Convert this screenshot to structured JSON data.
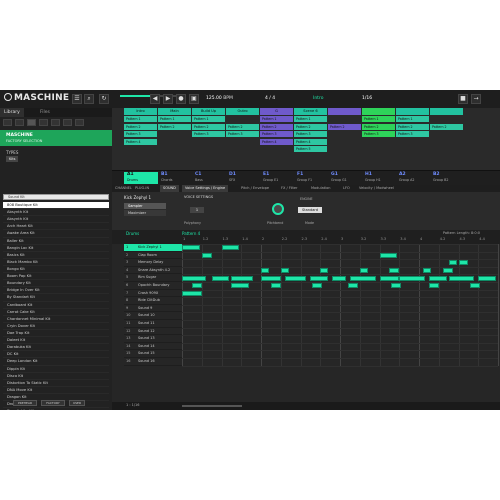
{
  "app": {
    "logo": "MASCHINE"
  },
  "topbar": {
    "bpm_value": "125.00",
    "bpm_unit": "BPM",
    "sig": "4 / 4",
    "nudge": "1/16",
    "mode": "Intro",
    "buttons": [
      "☰",
      "⌕",
      "↻",
      "◀",
      "▶",
      "●",
      "▣",
      "■",
      "→"
    ]
  },
  "library": {
    "tabs": [
      "Library",
      "Files"
    ],
    "factory_title": "MASCHINE",
    "factory_sub": "FACTORY SELECTION",
    "types_label": "TYPES",
    "kits_chip": "Kits",
    "search_value": "Sound Kit",
    "kits": [
      "808 Boutique Kit",
      "Absynth Kit",
      "Absynth Kit",
      "Arch Heart Kit",
      "Awake Area Kit",
      "Baller Kit",
      "Bangin Loc Kit",
      "Basics Kit",
      "Black Mambo Kit",
      "Bongo Kit",
      "Boom Pap Kit",
      "Boundary Kit",
      "Bridge In Over Kit",
      "By Standart Kit",
      "Cardboard Kit",
      "Carrot Cake Kit",
      "Chardonnet Minimal Kit",
      "Cryin Dover Kit",
      "Dae Trap Kit",
      "Daleet Kit",
      "Darabuka Kit",
      "DC Kit",
      "Deep London Kit",
      "Dippin Kit",
      "Disco Kit",
      "Distortion To Static Kit",
      "DNA Move Kit",
      "Dragon Kit",
      "Drony Gates Kit",
      "Drop It Like Kit",
      "Dub Rootz Kit",
      "Dub Tox A Kit"
    ],
    "footer": [
      "PREHEAR",
      "FACTORY",
      "USER"
    ]
  },
  "arranger": {
    "scenes": [
      {
        "label": "Intro",
        "color": "#22c2a0"
      },
      {
        "label": "Main",
        "color": "#22c2a0"
      },
      {
        "label": "Build Up",
        "color": "#22c2a0"
      },
      {
        "label": "Outro",
        "color": "#22c2a0"
      },
      {
        "label": "G",
        "color": "#6f5acb"
      },
      {
        "label": "Scene 6",
        "color": "#22c2a0"
      },
      {
        "label": "",
        "color": "#6f5acb"
      },
      {
        "label": "",
        "color": "#2ed35a"
      },
      {
        "label": "",
        "color": "#22c2a0"
      },
      {
        "label": "",
        "color": "#22c2a0"
      }
    ],
    "patterns": [
      {
        "row": 0,
        "col": 0,
        "label": "Pattern 1",
        "color": "#2ec7a2"
      },
      {
        "row": 0,
        "col": 1,
        "label": "Pattern 1",
        "color": "#2ec7a2"
      },
      {
        "row": 0,
        "col": 2,
        "label": "Pattern 1",
        "color": "#2ec7a2"
      },
      {
        "row": 0,
        "col": 4,
        "label": "Pattern 1",
        "color": "#6f5acb"
      },
      {
        "row": 0,
        "col": 5,
        "label": "Pattern 1",
        "color": "#2ec7a2"
      },
      {
        "row": 0,
        "col": 7,
        "label": "Pattern 1",
        "color": "#2ed35a"
      },
      {
        "row": 0,
        "col": 8,
        "label": "Pattern 1",
        "color": "#2ec7a2"
      },
      {
        "row": 1,
        "col": 0,
        "label": "Pattern 2",
        "color": "#2ec7a2"
      },
      {
        "row": 1,
        "col": 1,
        "label": "Pattern 2",
        "color": "#2ec7a2"
      },
      {
        "row": 1,
        "col": 2,
        "label": "Pattern 2",
        "color": "#2ec7a2"
      },
      {
        "row": 1,
        "col": 3,
        "label": "Pattern 2",
        "color": "#2ec7a2"
      },
      {
        "row": 1,
        "col": 4,
        "label": "Pattern 2",
        "color": "#6f5acb"
      },
      {
        "row": 1,
        "col": 5,
        "label": "Pattern 2",
        "color": "#2ec7a2"
      },
      {
        "row": 1,
        "col": 6,
        "label": "Pattern 2",
        "color": "#6f5acb"
      },
      {
        "row": 1,
        "col": 7,
        "label": "Pattern 2",
        "color": "#2ed35a"
      },
      {
        "row": 1,
        "col": 8,
        "label": "Pattern 2",
        "color": "#2ec7a2"
      },
      {
        "row": 1,
        "col": 9,
        "label": "Pattern 2",
        "color": "#2ec7a2"
      },
      {
        "row": 2,
        "col": 0,
        "label": "Pattern 3",
        "color": "#2ec7a2"
      },
      {
        "row": 2,
        "col": 2,
        "label": "Pattern 3",
        "color": "#2ec7a2"
      },
      {
        "row": 2,
        "col": 3,
        "label": "Pattern 3",
        "color": "#2ec7a2"
      },
      {
        "row": 2,
        "col": 4,
        "label": "Pattern 3",
        "color": "#6f5acb"
      },
      {
        "row": 2,
        "col": 5,
        "label": "Pattern 3",
        "color": "#2ec7a2"
      },
      {
        "row": 2,
        "col": 7,
        "label": "Pattern 3",
        "color": "#2ed35a"
      },
      {
        "row": 2,
        "col": 8,
        "label": "Pattern 3",
        "color": "#2ec7a2"
      },
      {
        "row": 3,
        "col": 0,
        "label": "Pattern 4",
        "color": "#2ec7a2"
      },
      {
        "row": 3,
        "col": 4,
        "label": "Pattern 4",
        "color": "#6f5acb"
      },
      {
        "row": 3,
        "col": 5,
        "label": "Pattern 4",
        "color": "#2ec7a2"
      },
      {
        "row": 4,
        "col": 5,
        "label": "Pattern 5",
        "color": "#2ec7a2"
      }
    ],
    "row_tints": [
      "Pattern 1",
      "Pattern 2",
      "Pattern 3",
      "Pattern 4"
    ]
  },
  "groups": [
    {
      "id": "A1",
      "name": "Drums",
      "selected": true
    },
    {
      "id": "B1",
      "name": "Chords"
    },
    {
      "id": "C1",
      "name": "Bass"
    },
    {
      "id": "D1",
      "name": "SFX"
    },
    {
      "id": "E1",
      "name": "Group E1"
    },
    {
      "id": "F1",
      "name": "Group F1"
    },
    {
      "id": "G1",
      "name": "Group G1"
    },
    {
      "id": "H1",
      "name": "Group H1"
    },
    {
      "id": "A2",
      "name": "Group A2"
    },
    {
      "id": "B2",
      "name": "Group B2"
    }
  ],
  "control": {
    "left_tabs": [
      "CHANNEL",
      "PLUG-IN",
      "SOUND"
    ],
    "tabs": [
      "Voice Settings / Engine",
      "Pitch / Envelope",
      "FX / Filter",
      "Modulation",
      "LFO",
      "Velocity / Modwheel"
    ],
    "sound_name": "Kick Zephyl 1",
    "plugins": [
      "Sampler",
      "Maximizer"
    ],
    "voice_settings_label": "VOICE SETTINGS",
    "engine_label": "ENGINE",
    "polyphony_value": "1",
    "polyphony_label": "Polyphony",
    "pitchbend_label": "Pitchbend",
    "mode_value": "Standard",
    "mode_label": "Mode"
  },
  "editor": {
    "drums_label": "Drums",
    "pattern_label": "Pattern 4",
    "pattern_length": "Pattern Length:  8:0:0",
    "ruler": [
      "1",
      "1.2",
      "1.3",
      "1.4",
      "2",
      "2.2",
      "2.3",
      "2.4",
      "3",
      "3.2",
      "3.3",
      "3.4",
      "4",
      "4.2",
      "4.3",
      "4.4"
    ],
    "sounds": [
      "Kick Zephyl 1",
      "Clap Room",
      "Memory Delay",
      "Snare Absynth 4.2",
      "Rim Sugar",
      "Opochh Boundary",
      "Crash 909X",
      "Ride ClitDub",
      "Sound 9",
      "Sound 10",
      "Sound 11",
      "Sound 12",
      "Sound 13",
      "Sound 14",
      "Sound 15",
      "Sound 16"
    ],
    "footer_left": "1 : 1/16",
    "notes": [
      {
        "row": 0,
        "start": 0.0,
        "len": 0.9
      },
      {
        "row": 0,
        "start": 2.0,
        "len": 0.9
      },
      {
        "row": 1,
        "start": 1.0,
        "len": 0.5
      },
      {
        "row": 1,
        "start": 10.0,
        "len": 0.9
      },
      {
        "row": 2,
        "start": 14.0,
        "len": 0.5
      },
      {
        "row": 2,
        "start": 13.5,
        "len": 0.4
      },
      {
        "row": 3,
        "start": 4.0,
        "len": 0.4
      },
      {
        "row": 3,
        "start": 5.0,
        "len": 0.4
      },
      {
        "row": 3,
        "start": 7.0,
        "len": 0.4
      },
      {
        "row": 3,
        "start": 9.0,
        "len": 0.4
      },
      {
        "row": 3,
        "start": 10.5,
        "len": 0.5
      },
      {
        "row": 3,
        "start": 12.2,
        "len": 0.4
      },
      {
        "row": 3,
        "start": 13.2,
        "len": 0.5
      },
      {
        "row": 4,
        "start": 0.0,
        "len": 1.2
      },
      {
        "row": 4,
        "start": 1.5,
        "len": 0.9
      },
      {
        "row": 4,
        "start": 2.5,
        "len": 1.1
      },
      {
        "row": 4,
        "start": 4.0,
        "len": 1.0
      },
      {
        "row": 4,
        "start": 5.2,
        "len": 1.1
      },
      {
        "row": 4,
        "start": 6.5,
        "len": 0.9
      },
      {
        "row": 4,
        "start": 7.6,
        "len": 0.7
      },
      {
        "row": 4,
        "start": 8.5,
        "len": 1.3
      },
      {
        "row": 4,
        "start": 10.0,
        "len": 1.0
      },
      {
        "row": 4,
        "start": 11.0,
        "len": 1.3
      },
      {
        "row": 4,
        "start": 12.5,
        "len": 0.9
      },
      {
        "row": 4,
        "start": 13.5,
        "len": 1.3
      },
      {
        "row": 4,
        "start": 15.0,
        "len": 0.9
      },
      {
        "row": 5,
        "start": 0.5,
        "len": 0.5
      },
      {
        "row": 5,
        "start": 2.5,
        "len": 0.9
      },
      {
        "row": 5,
        "start": 4.5,
        "len": 0.5
      },
      {
        "row": 5,
        "start": 6.6,
        "len": 0.5
      },
      {
        "row": 5,
        "start": 8.4,
        "len": 0.5
      },
      {
        "row": 5,
        "start": 10.6,
        "len": 0.5
      },
      {
        "row": 5,
        "start": 12.5,
        "len": 0.5
      },
      {
        "row": 5,
        "start": 14.6,
        "len": 0.5
      },
      {
        "row": 6,
        "start": 0.0,
        "len": 1.0
      }
    ]
  }
}
